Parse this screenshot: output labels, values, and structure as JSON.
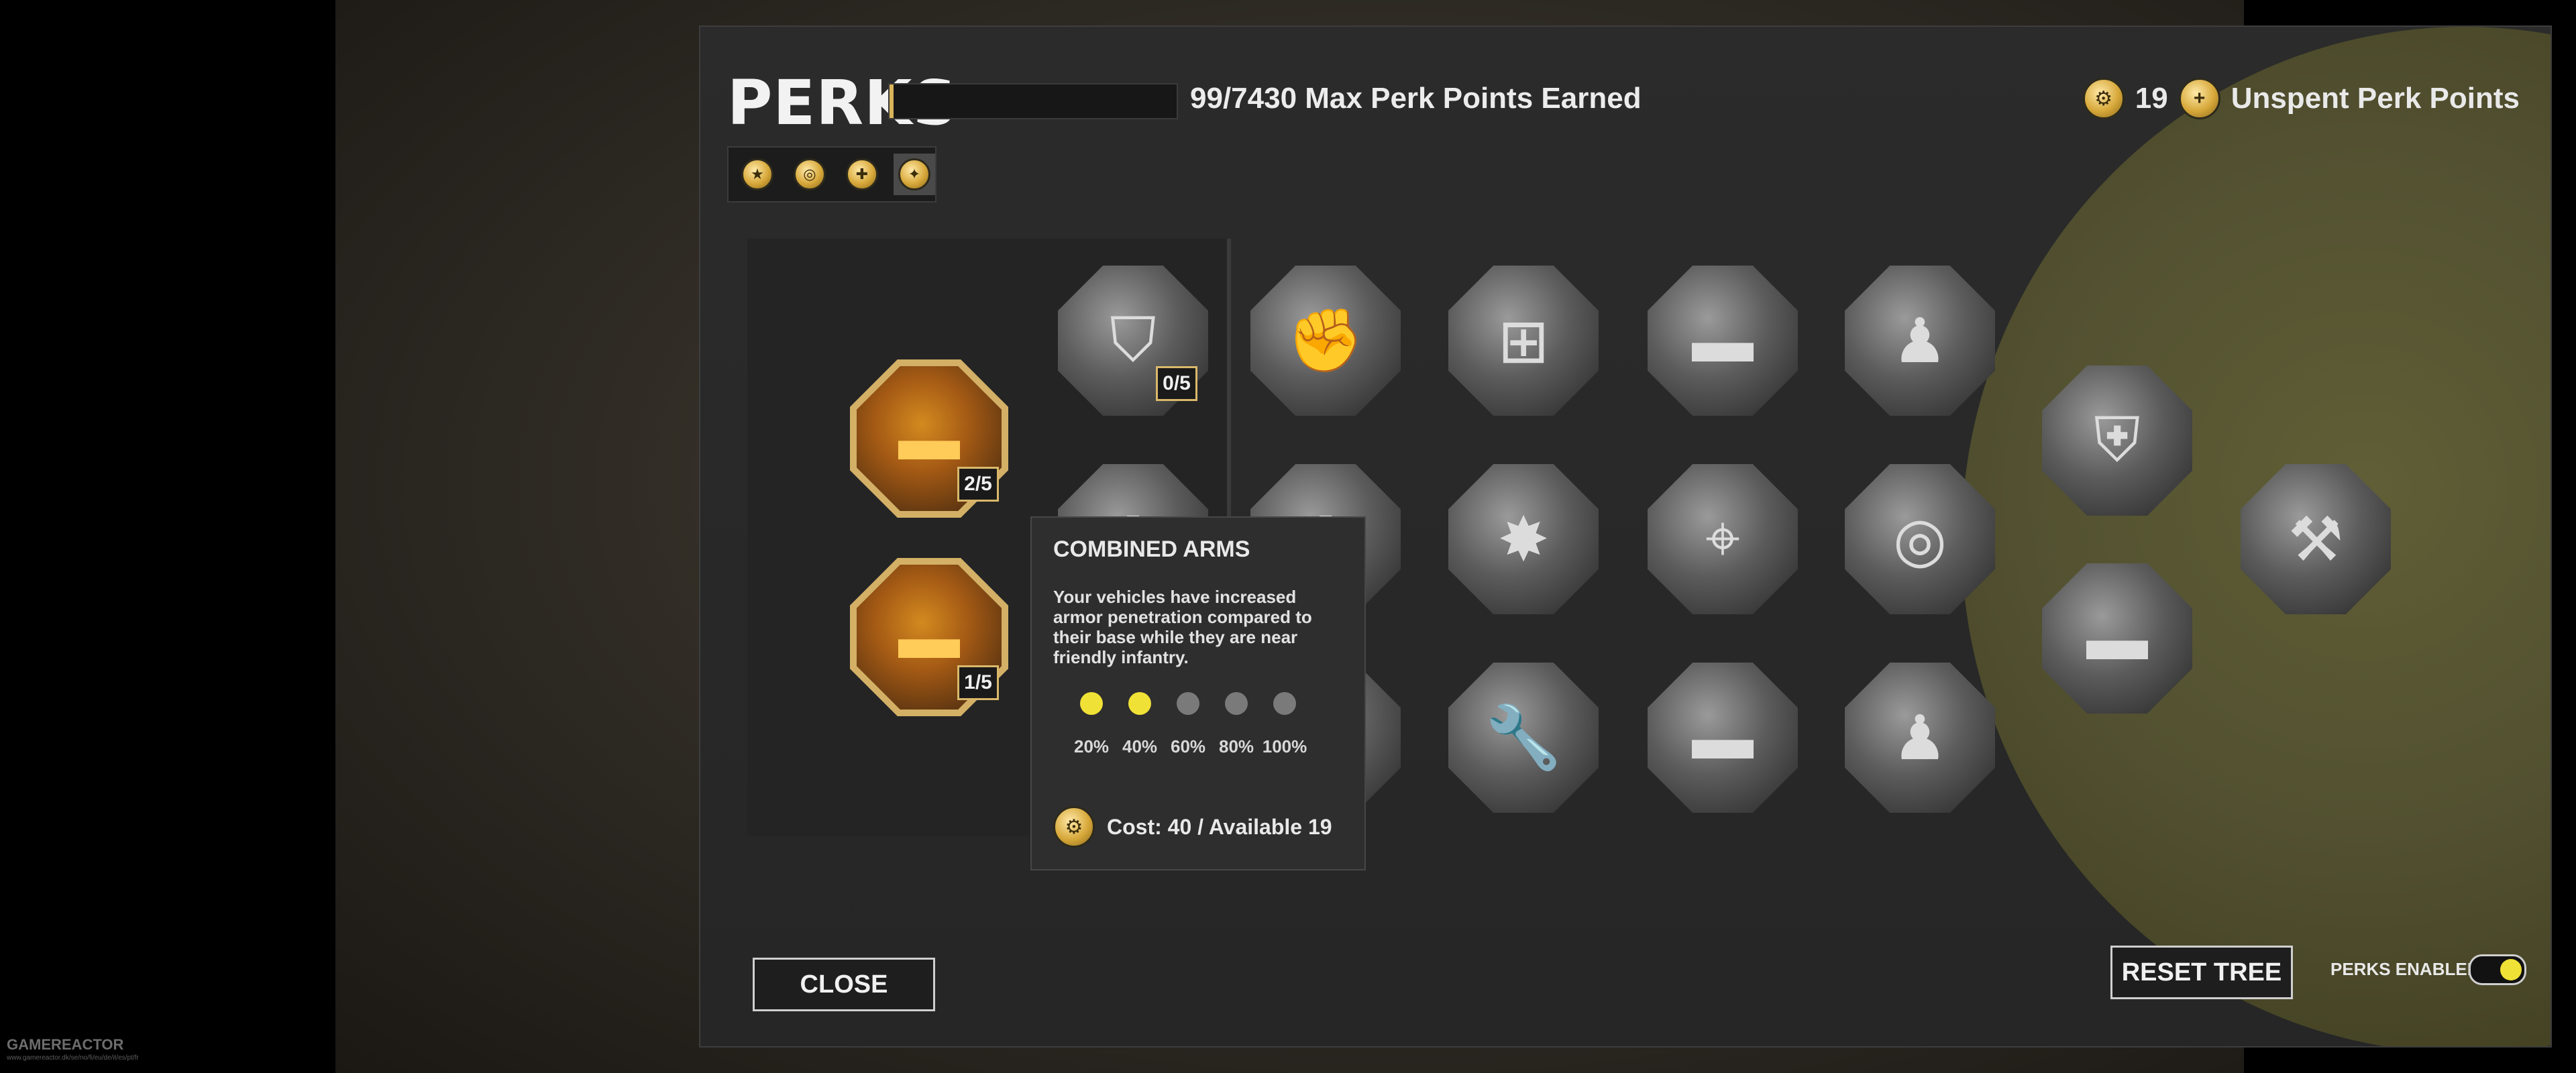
{
  "header": {
    "title": "PERKS",
    "progress_text": "99/7430 Max Perk Points Earned",
    "progress_fraction": 0.0133,
    "perk_points": "19",
    "unspent_label": "Unspent Perk Points"
  },
  "tabs": [
    {
      "icon": "gold-star-medal-icon",
      "glyph": "★",
      "active": false
    },
    {
      "icon": "ring-medal-icon",
      "glyph": "◎",
      "active": false
    },
    {
      "icon": "iron-cross-medal-icon",
      "glyph": "✚",
      "active": false
    },
    {
      "icon": "gold-emblem-medal-icon",
      "glyph": "✦",
      "active": true
    }
  ],
  "unlocked_perks": [
    {
      "icon": "tank-with-infantry-icon",
      "glyph": "▬",
      "rank": "2/5"
    },
    {
      "icon": "tank-repair-wrench-icon",
      "glyph": "▬",
      "rank": "1/5"
    }
  ],
  "grid_perks": [
    {
      "icon": "infantry-barricade-up-icon",
      "glyph": "⛉",
      "rank": "0/5"
    },
    {
      "icon": "fist-plus-icon",
      "glyph": "✊"
    },
    {
      "icon": "medkit-crate-down-icon",
      "glyph": "⊞"
    },
    {
      "icon": "tank-speed-icon",
      "glyph": "▬"
    },
    {
      "icon": "soldier-up-icon",
      "glyph": "♟"
    },
    {
      "icon": "infantry-plus-icon",
      "glyph": "✚"
    },
    {
      "icon": "fist-plus-icon",
      "glyph": "✚"
    },
    {
      "icon": "explosion-tank-icon",
      "glyph": "✸"
    },
    {
      "icon": "soldier-crosshair-icon",
      "glyph": "⌖"
    },
    {
      "icon": "crosshair-speed-up-icon",
      "glyph": "◎"
    },
    {
      "icon": "machine-gun-shield-icon",
      "glyph": "⛨"
    },
    {
      "icon": "weapons-bundle-icon",
      "glyph": "⚒"
    },
    {
      "icon": "wrench-shield-icon",
      "glyph": "🔧"
    },
    {
      "icon": "tank-crosshair-icon",
      "glyph": "▬"
    },
    {
      "icon": "soldier-clock-icon",
      "glyph": "♟"
    },
    {
      "icon": "tank-up-area-icon",
      "glyph": "▬"
    },
    {
      "icon": "perk-icon",
      "glyph": "✚"
    }
  ],
  "tooltip": {
    "title": "COMBINED ARMS",
    "description": "Your vehicles have increased armor penetration compared to their base while they are near friendly infantry.",
    "levels": [
      {
        "label": "20%",
        "filled": true
      },
      {
        "label": "40%",
        "filled": true
      },
      {
        "label": "60%",
        "filled": false
      },
      {
        "label": "80%",
        "filled": false
      },
      {
        "label": "100%",
        "filled": false
      }
    ],
    "cost_text": "Cost: 40 / Available 19"
  },
  "buttons": {
    "close": "CLOSE",
    "reset": "RESET TREE",
    "perks_enabled": "PERKS ENABLED"
  },
  "watermark": {
    "brand": "GAMEREACTOR",
    "url": "www.gamereactor.dk/se/no/fi/eu/de/it/es/pt/fr"
  },
  "colors": {
    "gold": "#d8b45a",
    "dot_filled": "#f0e136",
    "dot_empty": "#7a7a7a"
  }
}
